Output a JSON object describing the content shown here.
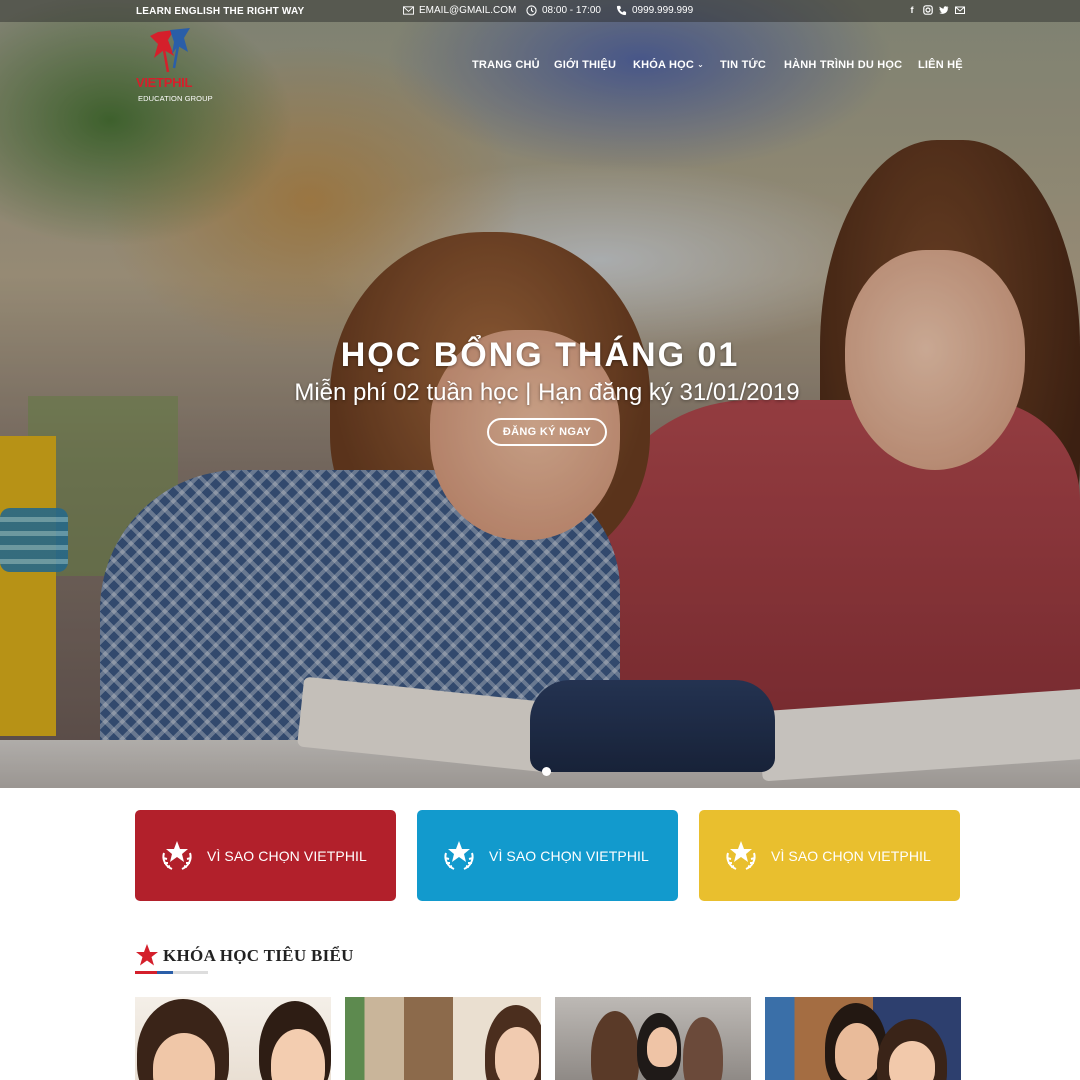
{
  "topbar": {
    "tagline": "LEARN ENGLISH THE RIGHT WAY",
    "email": "EMAIL@GMAIL.COM",
    "hours": "08:00 - 17:00",
    "phone": "0999.999.999",
    "socials": [
      "facebook-icon",
      "instagram-icon",
      "twitter-icon",
      "mail-icon"
    ]
  },
  "logo": {
    "brand": "VIETPHIL",
    "subtitle": "EDUCATION GROUP"
  },
  "nav": {
    "items": [
      {
        "label": "TRANG CHỦ"
      },
      {
        "label": "GIỚI THIỆU"
      },
      {
        "label": "KHÓA HỌC",
        "has_dropdown": true
      },
      {
        "label": "TIN TỨC"
      },
      {
        "label": "HÀNH TRÌNH DU HỌC"
      },
      {
        "label": "LIÊN HỆ"
      }
    ]
  },
  "hero": {
    "title": "HỌC BỔNG THÁNG 01",
    "subtitle": "Miễn phí 02 tuần học | Hạn đăng ký 31/01/2019",
    "button": "ĐĂNG KÝ NGAY"
  },
  "features": [
    {
      "label": "VÌ SAO CHỌN VIETPHIL",
      "color": "#b2202b"
    },
    {
      "label": "VÌ SAO CHỌN VIETPHIL",
      "color": "#129acd"
    },
    {
      "label": "VÌ SAO CHỌN VIETPHIL",
      "color": "#e9bf2e"
    }
  ],
  "section": {
    "title": "KHÓA HỌC TIÊU BIỂU",
    "accent_red": "#d41f2b",
    "accent_blue": "#2a5ea8"
  }
}
